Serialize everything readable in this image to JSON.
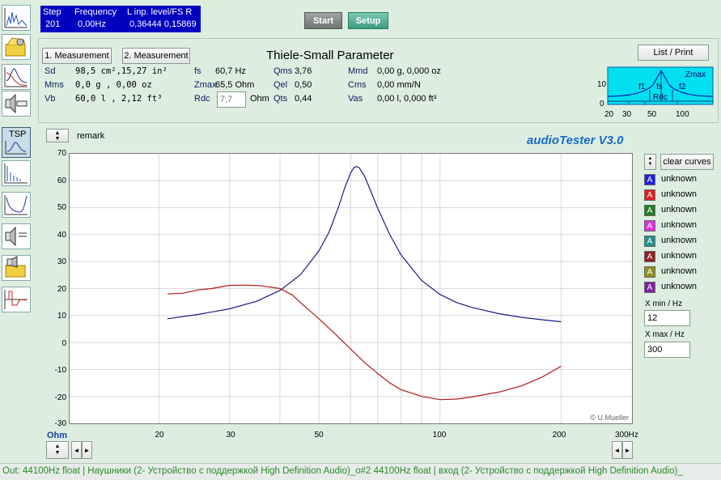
{
  "status": {
    "step_label": "Step",
    "step_value": "201",
    "freq_label": "Frequency",
    "freq_value": "0,00Hz",
    "level_label": "L inp. level/FS  R",
    "level_value": "0,36444  0,15869"
  },
  "toolbar": {
    "start": "Start",
    "setup": "Setup"
  },
  "tsp": {
    "btn_measurement1": "1. Measurement",
    "btn_measurement2": "2. Measurement",
    "title": "Thiele-Small Parameter",
    "list_print": "List / Print",
    "sd_label": "Sd",
    "sd_value": "98,5  cm²,15,27  in²",
    "mms_label": "Mms",
    "mms_value": "0,0  g   , 0,00  oz",
    "vb_label": "Vb",
    "vb_value": "60,0  l   , 2,12  ft³",
    "fs_label": "fs",
    "fs_value": "60,7 Hz",
    "zmax_label": "Zmax",
    "zmax_value": "65,5 Ohm",
    "rdc_label": "Rdc",
    "rdc_value": "7,7",
    "rdc_unit": "Ohm",
    "qms_label": "Qms",
    "qms_value": "3,76",
    "qel_label": "Qel",
    "qel_value": "0,50",
    "qts_label": "Qts",
    "qts_value": "0,44",
    "mmd_label": "Mmd",
    "mmd_value": "0,00 g, 0,000 oz",
    "cms_label": "Cms",
    "cms_value": "0,00 mm/N",
    "vas_label": "Vas",
    "vas_value": "0,00 l, 0,000 ft³",
    "mini": {
      "zmax": "Zmax",
      "f1": "f1",
      "fs": "fs",
      "f2": "f2",
      "rdc": "Rdc",
      "y_top": "10",
      "y_bottom": "0",
      "x_ticks": [
        "20",
        "30",
        "50",
        "100"
      ]
    }
  },
  "plot_header": {
    "remark": "remark",
    "brand": "audioTester  V3.0",
    "credit": "© U.Mueller"
  },
  "left_tools": {
    "tsp_label": "TSP",
    "icons": [
      "spectrum-icon",
      "speaker-folder-icon",
      "impedance-icon",
      "speaker-driver-icon",
      "tsp-icon",
      "waterfall-icon",
      "bass-curve-icon",
      "speaker-measure-icon",
      "speaker-folder2-icon",
      "step-response-icon"
    ]
  },
  "chart_data": {
    "type": "line",
    "xscale": "log",
    "xlim": [
      12,
      300
    ],
    "ylim": [
      -30,
      70
    ],
    "y_ticks": [
      "70",
      "60",
      "50",
      "40",
      "30",
      "20",
      "10",
      "0",
      "-10",
      "-20",
      "-30"
    ],
    "x_ticks": [
      "20",
      "30",
      "50",
      "100",
      "200",
      "300Hz"
    ],
    "y_unit": "Ohm",
    "series": [
      {
        "color": "#1a1a8c",
        "x": [
          21,
          25,
          30,
          35,
          40,
          45,
          50,
          53,
          56,
          58,
          60,
          61,
          62,
          63,
          65,
          67,
          70,
          75,
          80,
          90,
          100,
          110,
          120,
          140,
          160,
          180,
          200
        ],
        "y": [
          8.8,
          10.4,
          12.5,
          15.3,
          19.3,
          25.2,
          34.0,
          41.0,
          50.5,
          57.5,
          63.0,
          64.8,
          65.3,
          64.8,
          61.5,
          56.8,
          49.8,
          40.0,
          32.5,
          23.0,
          17.8,
          14.8,
          13.0,
          10.7,
          9.3,
          8.4,
          7.7
        ]
      },
      {
        "color": "#b01a1a",
        "x": [
          21,
          23,
          25,
          27,
          30,
          33,
          36,
          40,
          43,
          46,
          50,
          55,
          60,
          65,
          70,
          75,
          80,
          90,
          100,
          110,
          120,
          140,
          160,
          180,
          200
        ],
        "y": [
          18.0,
          18.3,
          19.5,
          20.0,
          21.2,
          21.3,
          21.0,
          20.0,
          17.5,
          13.5,
          8.8,
          3.0,
          -2.5,
          -7.5,
          -11.5,
          -15.0,
          -17.5,
          -20.0,
          -21.2,
          -21.0,
          -20.2,
          -18.4,
          -16.0,
          -12.7,
          -8.8
        ]
      }
    ]
  },
  "legend": {
    "clear_curves": "clear curves",
    "swatch_letter": "A",
    "entries": [
      {
        "name": "unknown",
        "color": "#2020e0"
      },
      {
        "name": "unknown",
        "color": "#e02020"
      },
      {
        "name": "unknown",
        "color": "#208020"
      },
      {
        "name": "unknown",
        "color": "#e030e0"
      },
      {
        "name": "unknown",
        "color": "#209090"
      },
      {
        "name": "unknown",
        "color": "#902020"
      },
      {
        "name": "unknown",
        "color": "#909020"
      },
      {
        "name": "unknown",
        "color": "#8020a0"
      }
    ]
  },
  "range": {
    "xmin_label": "X min / Hz",
    "xmin_value": "12",
    "xmax_label": "X max / Hz",
    "xmax_value": "300"
  },
  "statusbar": {
    "text": "Out: 44100Hz float  | Наушники (2- Устройство с поддержкой High Definition Audio)_o#2  44100Hz float  | вход (2- Устройство с поддержкой High Definition Audio)_"
  }
}
